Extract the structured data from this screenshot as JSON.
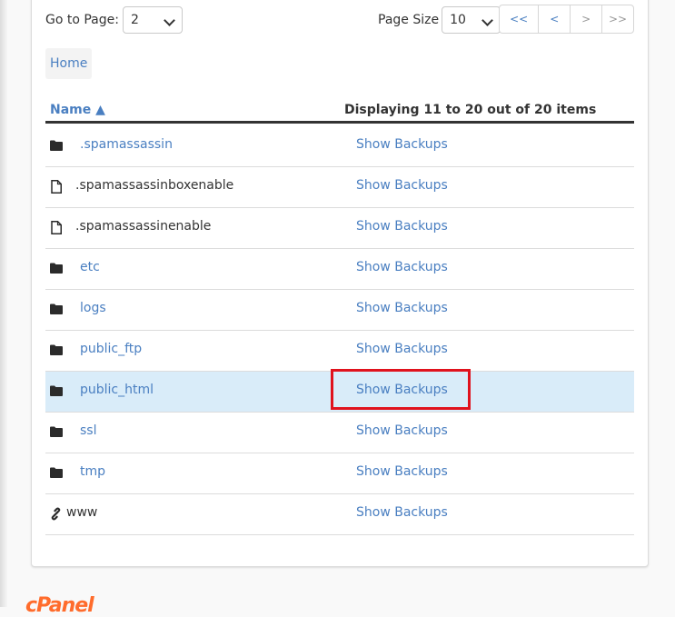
{
  "pagination": {
    "goto_label": "Go to Page:",
    "goto_value": "2",
    "page_size_label": "Page Size",
    "page_size_value": "10",
    "buttons": [
      {
        "label": "<<",
        "enabled": true
      },
      {
        "label": "<",
        "enabled": true
      },
      {
        "label": ">",
        "enabled": false
      },
      {
        "label": ">>",
        "enabled": false
      }
    ]
  },
  "breadcrumb": {
    "home": "Home"
  },
  "table": {
    "name_header": "Name ▲",
    "display_header": "Displaying 11 to 20 out of 20 items",
    "rows": [
      {
        "name": ".spamassassin",
        "type": "folder",
        "action": "Show Backups"
      },
      {
        "name": ".spamassassinboxenable",
        "type": "file",
        "action": "Show Backups"
      },
      {
        "name": ".spamassassinenable",
        "type": "file",
        "action": "Show Backups"
      },
      {
        "name": "etc",
        "type": "folder",
        "action": "Show Backups"
      },
      {
        "name": "logs",
        "type": "folder",
        "action": "Show Backups"
      },
      {
        "name": "public_ftp",
        "type": "folder",
        "action": "Show Backups"
      },
      {
        "name": "public_html",
        "type": "folder",
        "action": "Show Backups",
        "highlighted": true
      },
      {
        "name": "ssl",
        "type": "folder",
        "action": "Show Backups"
      },
      {
        "name": "tmp",
        "type": "folder",
        "action": "Show Backups"
      },
      {
        "name": "www",
        "type": "symlink",
        "action": "Show Backups"
      }
    ]
  },
  "annotation": {
    "target_row": "public_html",
    "color": "#e0121d"
  },
  "footer": {
    "logo": "cPanel"
  },
  "colors": {
    "link": "#4a7fc1",
    "highlight_row": "#d9ecf9",
    "logo": "#ff6c2c"
  }
}
